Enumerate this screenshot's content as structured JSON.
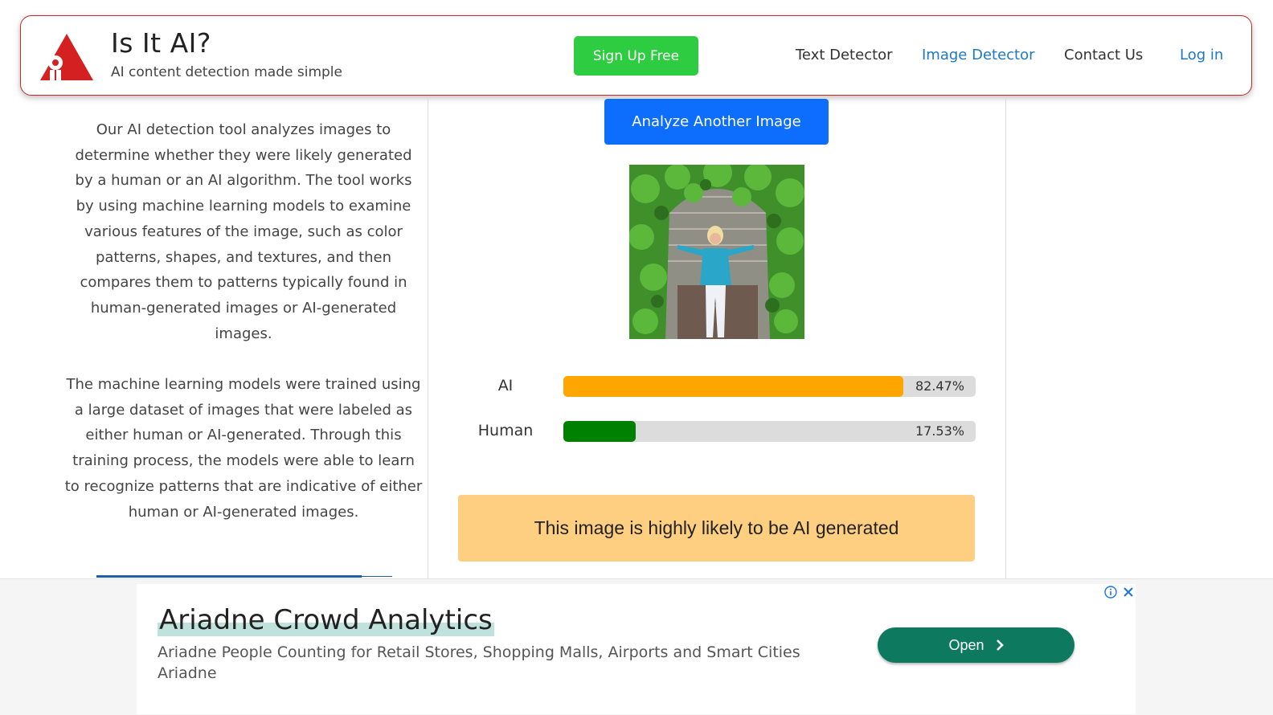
{
  "header": {
    "title": "Is It AI?",
    "subtitle": "AI content detection made simple",
    "signup_label": "Sign Up Free",
    "nav": {
      "text_detector": "Text Detector",
      "image_detector": "Image Detector",
      "contact_us": "Contact Us",
      "login": "Log in"
    }
  },
  "left": {
    "paragraph1": "Our AI detection tool analyzes images to determine whether they were likely generated by a human or an AI algorithm. The tool works by using machine learning models to examine various features of the image, such as color patterns, shapes, and textures, and then compares them to patterns typically found in human-generated images or AI-generated images.",
    "paragraph2": "The machine learning models were trained using a large dataset of images that were labeled as either human or AI-generated. Through this training process, the models were able to learn to recognize patterns that are indicative of either human or AI-generated images."
  },
  "main": {
    "analyze_label": "Analyze Another Image",
    "results": [
      {
        "label": "AI",
        "percent_text": "82.47%",
        "value": 82.47,
        "color": "#ffa500"
      },
      {
        "label": "Human",
        "percent_text": "17.53%",
        "value": 17.53,
        "color": "#008000"
      }
    ],
    "verdict": "This image is highly likely to be AI generated"
  },
  "ad": {
    "title": "Ariadne Crowd Analytics",
    "description": "Ariadne People Counting for Retail Stores, Shopping Malls, Airports and Smart Cities",
    "advertiser": "Ariadne",
    "open_label": "Open"
  },
  "icons": {
    "logo": "red-triangle-robot-logo",
    "info": "info-icon",
    "close": "close-icon",
    "chevron": "chevron-right-icon"
  },
  "colors": {
    "brand_red": "#c0282d",
    "signup_green": "#2ecc40",
    "primary_blue": "#0d6efd",
    "ai_bar": "#ffa500",
    "human_bar": "#008000",
    "verdict_bg": "#fecf80",
    "ad_button": "#0d7a5f"
  }
}
